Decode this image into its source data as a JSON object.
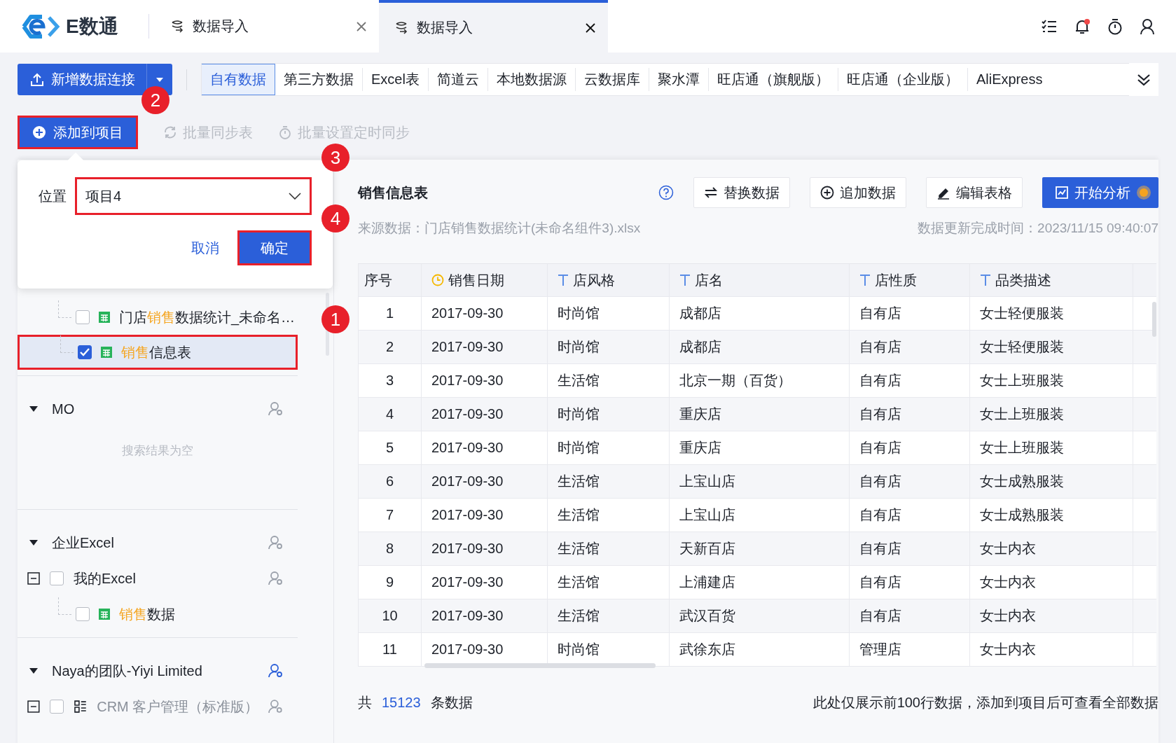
{
  "app": {
    "logo_text": "E数通"
  },
  "tabs": [
    {
      "label": "数据导入",
      "selected": false
    },
    {
      "label": "数据导入",
      "selected": true
    }
  ],
  "header": {
    "has_notification": true
  },
  "new_connection_button": "新增数据连接",
  "source_tabs": [
    {
      "label": "自有数据",
      "selected": true
    },
    {
      "label": "第三方数据",
      "selected": false
    },
    {
      "label": "Excel表",
      "selected": false
    },
    {
      "label": "简道云",
      "selected": false
    },
    {
      "label": "本地数据源",
      "selected": false
    },
    {
      "label": "云数据库",
      "selected": false
    },
    {
      "label": "聚水潭",
      "selected": false
    },
    {
      "label": "旺店通（旗舰版）",
      "selected": false
    },
    {
      "label": "旺店通（企业版）",
      "selected": false
    },
    {
      "label": "AliExpress",
      "selected": false
    }
  ],
  "actions": [
    {
      "label": "添加到项目",
      "kind": "add",
      "disabled": false,
      "highlighted": true
    },
    {
      "label": "批量同步表",
      "kind": "sync",
      "disabled": true,
      "highlighted": false
    },
    {
      "label": "批量设置定时同步",
      "kind": "timer",
      "disabled": true,
      "highlighted": false
    }
  ],
  "popover": {
    "label": "位置",
    "value": "项目4",
    "value_highlighted": true,
    "cancel": "取消",
    "confirm": "确定",
    "confirm_highlighted": true
  },
  "tree": [
    {
      "items": [
        {
          "kind": "table",
          "name_parts": [
            {
              "text": "门店",
              "match": false
            },
            {
              "text": "销售",
              "match": true
            },
            {
              "text": "数据统计_未命名…",
              "match": false
            }
          ],
          "checked": false,
          "selected": false,
          "highlighted": false
        },
        {
          "kind": "table",
          "name_parts": [
            {
              "text": "销售",
              "match": true
            },
            {
              "text": "信息表",
              "match": false
            }
          ],
          "checked": true,
          "selected": true,
          "highlighted": true
        }
      ]
    },
    {
      "title": "MO",
      "shared": false,
      "empty_text": "搜索结果为空"
    },
    {
      "title": "企业Excel",
      "shared": false,
      "items": [
        {
          "kind": "folder",
          "name_parts": [
            {
              "text": "我的Excel",
              "match": false
            }
          ],
          "checked": false,
          "expanded": true,
          "disabled": false,
          "children": [
            {
              "kind": "table",
              "name_parts": [
                {
                  "text": "销售",
                  "match": true
                },
                {
                  "text": "数据",
                  "match": false
                }
              ],
              "checked": false,
              "selected": false,
              "highlighted": false
            }
          ]
        }
      ]
    },
    {
      "title": "Naya的团队-Yiyi Limited",
      "shared": true,
      "items": [
        {
          "kind": "app",
          "name_parts": [
            {
              "text": "CRM 客户管理（标准版）",
              "match": false
            }
          ],
          "checked": false,
          "expanded": true,
          "disabled": true
        }
      ]
    }
  ],
  "detail": {
    "title": "销售信息表",
    "buttons": [
      {
        "label": "替换数据",
        "kind": "replace"
      },
      {
        "label": "追加数据",
        "kind": "append"
      },
      {
        "label": "编辑表格",
        "kind": "edit"
      },
      {
        "label": "开始分析",
        "kind": "analyze"
      }
    ],
    "source": "来源数据：门店销售数据统计(未命名组件3).xlsx",
    "updated": "数据更新完成时间：2023/11/15 09:40:07"
  },
  "table": {
    "columns": [
      {
        "label": "序号",
        "kind": "index"
      },
      {
        "label": "销售日期",
        "kind": "date"
      },
      {
        "label": "店风格",
        "kind": "text"
      },
      {
        "label": "店名",
        "kind": "text"
      },
      {
        "label": "店性质",
        "kind": "text"
      },
      {
        "label": "品类描述",
        "kind": "text"
      }
    ],
    "rows": [
      [
        "1",
        "2017-09-30",
        "时尚馆",
        "成都店",
        "自有店",
        "女士轻便服装"
      ],
      [
        "2",
        "2017-09-30",
        "时尚馆",
        "成都店",
        "自有店",
        "女士轻便服装"
      ],
      [
        "3",
        "2017-09-30",
        "生活馆",
        "北京一期（百货）",
        "自有店",
        "女士上班服装"
      ],
      [
        "4",
        "2017-09-30",
        "时尚馆",
        "重庆店",
        "自有店",
        "女士上班服装"
      ],
      [
        "5",
        "2017-09-30",
        "时尚馆",
        "重庆店",
        "自有店",
        "女士上班服装"
      ],
      [
        "6",
        "2017-09-30",
        "生活馆",
        "上宝山店",
        "自有店",
        "女士成熟服装"
      ],
      [
        "7",
        "2017-09-30",
        "生活馆",
        "上宝山店",
        "自有店",
        "女士成熟服装"
      ],
      [
        "8",
        "2017-09-30",
        "生活馆",
        "天新百店",
        "自有店",
        "女士内衣"
      ],
      [
        "9",
        "2017-09-30",
        "生活馆",
        "上浦建店",
        "自有店",
        "女士内衣"
      ],
      [
        "10",
        "2017-09-30",
        "生活馆",
        "武汉百货",
        "自有店",
        "女士内衣"
      ],
      [
        "11",
        "2017-09-30",
        "时尚馆",
        "武徐东店",
        "管理店",
        "女士内衣"
      ]
    ]
  },
  "footer": {
    "prefix": "共",
    "count": "15123",
    "suffix": "条数据",
    "note": "此处仅展示前100行数据，添加到项目后可查看全部数据"
  },
  "annotations": [
    "1",
    "2",
    "3",
    "4"
  ]
}
